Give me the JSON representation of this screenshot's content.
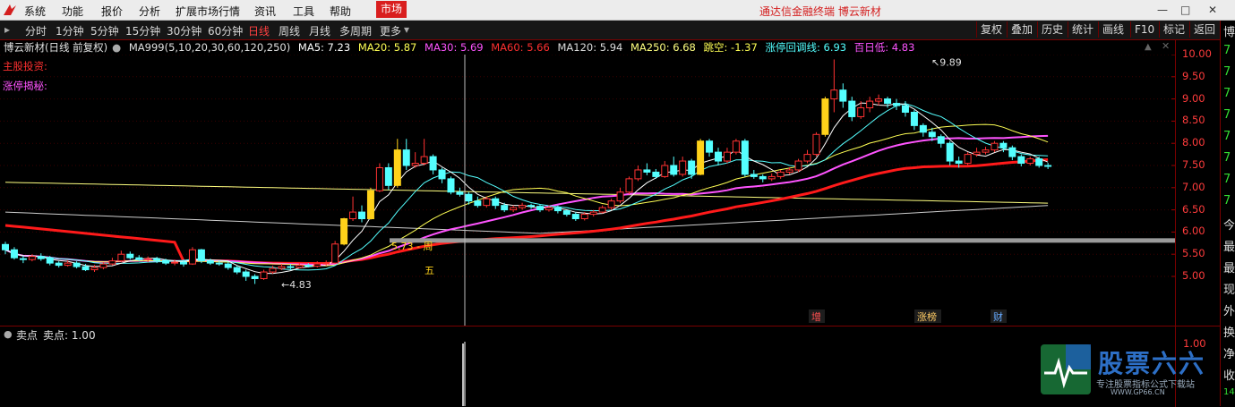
{
  "menubar": {
    "items": [
      "系统",
      "功能",
      "报价",
      "分析",
      "扩展市场行情",
      "资讯",
      "工具",
      "帮助"
    ],
    "market_label": "市场",
    "title": "通达信金融终端  博云新材"
  },
  "toolbar": {
    "periods": [
      "分时",
      "1分钟",
      "5分钟",
      "15分钟",
      "30分钟",
      "60分钟",
      "日线",
      "周线",
      "月线",
      "多周期",
      "更多"
    ],
    "active_period": "日线",
    "right_buttons": [
      "复权",
      "叠加",
      "历史",
      "统计",
      "画线",
      "F10",
      "标记",
      "返回"
    ]
  },
  "info": {
    "stock": "博云新材(日线 前复权)",
    "indicator": "MA999(5,10,20,30,60,120,250)",
    "ma5": "MA5: 7.23",
    "ma20": "MA20: 5.87",
    "ma30": "MA30: 5.69",
    "ma60": "MA60: 5.66",
    "ma120": "MA120: 5.94",
    "ma250": "MA250: 6.68",
    "jump": "跳空: -1.37",
    "limit_pullback": "涨停回调线: 6.93",
    "hundred_low": "百日低: 4.83"
  },
  "labels": {
    "main_fund": "主股投资:",
    "limit_up": "涨停揭秘:",
    "annot_left": "5.73 - 周",
    "annot_week": "五",
    "low_mark": "4.83",
    "high_mark": "9.89",
    "tag_zeng": "增",
    "tag_zhangbang": "涨榜",
    "tag_cai": "财"
  },
  "sub": {
    "title": "卖点",
    "value": "卖点: 1.00",
    "ticks": [
      "1.00"
    ]
  },
  "right_strip": [
    "博",
    "7",
    "7",
    "7",
    "7",
    "7",
    "7",
    "7",
    "7",
    "今",
    "最",
    "最",
    "现",
    "外",
    "换",
    "净",
    "收",
    "14"
  ],
  "watermark": {
    "brand": "股票六六",
    "slogan": "专注股票指标公式下载站",
    "url": "WWW.GP66.CN"
  },
  "colors": {
    "up": "#ff3232",
    "down": "#54ffff",
    "ma5": "#ffffff",
    "ma20": "#ffff54",
    "ma30": "#ff54ff",
    "ma60": "#ff1a1a",
    "ma120": "#cccccc",
    "ma250": "#ffff80"
  },
  "chart_data": {
    "type": "candlestick",
    "title": "博云新材(日线 前复权)",
    "y_ticks": [
      5.0,
      5.5,
      6.0,
      6.5,
      7.0,
      7.5,
      8.0,
      8.5,
      9.0,
      9.5,
      10.0
    ],
    "ylim": [
      4.7,
      10.1
    ],
    "candles": [
      [
        5.72,
        5.6,
        5.78,
        5.5
      ],
      [
        5.6,
        5.42,
        5.66,
        5.38
      ],
      [
        5.4,
        5.38,
        5.46,
        5.3
      ],
      [
        5.38,
        5.45,
        5.5,
        5.34
      ],
      [
        5.45,
        5.4,
        5.52,
        5.35
      ],
      [
        5.42,
        5.3,
        5.46,
        5.25
      ],
      [
        5.3,
        5.25,
        5.34,
        5.2
      ],
      [
        5.25,
        5.3,
        5.36,
        5.22
      ],
      [
        5.3,
        5.22,
        5.34,
        5.18
      ],
      [
        5.22,
        5.15,
        5.28,
        5.12
      ],
      [
        5.15,
        5.2,
        5.26,
        5.1
      ],
      [
        5.2,
        5.28,
        5.32,
        5.16
      ],
      [
        5.28,
        5.35,
        5.42,
        5.25
      ],
      [
        5.35,
        5.5,
        5.58,
        5.32
      ],
      [
        5.5,
        5.42,
        5.56,
        5.38
      ],
      [
        5.42,
        5.38,
        5.48,
        5.34
      ],
      [
        5.38,
        5.4,
        5.45,
        5.32
      ],
      [
        5.4,
        5.36,
        5.44,
        5.3
      ],
      [
        5.36,
        5.3,
        5.4,
        5.26
      ],
      [
        5.3,
        5.32,
        5.38,
        5.25
      ],
      [
        5.32,
        5.28,
        5.38,
        5.22
      ],
      [
        5.28,
        5.6,
        5.66,
        5.26
      ],
      [
        5.6,
        5.35,
        5.62,
        5.3
      ],
      [
        5.35,
        5.3,
        5.4,
        5.26
      ],
      [
        5.3,
        5.28,
        5.36,
        5.24
      ],
      [
        5.28,
        5.2,
        5.32,
        5.15
      ],
      [
        5.2,
        5.1,
        5.25,
        5.05
      ],
      [
        5.1,
        5.0,
        5.15,
        4.9
      ],
      [
        5.0,
        4.95,
        5.05,
        4.83
      ],
      [
        4.95,
        5.1,
        5.15,
        4.92
      ],
      [
        5.1,
        5.18,
        5.24,
        5.06
      ],
      [
        5.18,
        5.22,
        5.28,
        5.14
      ],
      [
        5.22,
        5.2,
        5.28,
        5.16
      ],
      [
        5.2,
        5.25,
        5.3,
        5.18
      ],
      [
        5.25,
        5.23,
        5.3,
        5.2
      ],
      [
        5.23,
        5.28,
        5.34,
        5.2
      ],
      [
        5.28,
        5.3,
        5.36,
        5.24
      ],
      [
        5.3,
        5.73,
        5.8,
        5.28
      ],
      [
        5.73,
        6.3,
        6.32,
        5.7
      ],
      [
        6.3,
        6.45,
        6.8,
        6.25
      ],
      [
        6.45,
        6.3,
        6.6,
        6.22
      ],
      [
        6.3,
        6.93,
        7.0,
        6.28
      ],
      [
        6.93,
        7.45,
        7.55,
        6.9
      ],
      [
        7.45,
        7.05,
        7.55,
        6.95
      ],
      [
        7.05,
        7.85,
        8.1,
        7.0
      ],
      [
        7.85,
        7.5,
        8.1,
        7.4
      ],
      [
        7.5,
        7.55,
        7.8,
        7.45
      ],
      [
        7.55,
        7.7,
        8.1,
        7.5
      ],
      [
        7.7,
        7.4,
        7.75,
        7.3
      ],
      [
        7.4,
        7.2,
        7.45,
        7.1
      ],
      [
        7.2,
        6.9,
        7.25,
        6.85
      ],
      [
        6.9,
        6.85,
        7.0,
        6.8
      ],
      [
        6.85,
        6.7,
        6.9,
        6.62
      ],
      [
        6.7,
        6.6,
        6.8,
        6.55
      ],
      [
        6.6,
        6.75,
        6.8,
        6.55
      ],
      [
        6.75,
        6.6,
        6.8,
        6.52
      ],
      [
        6.6,
        6.5,
        6.66,
        6.45
      ],
      [
        6.5,
        6.55,
        6.6,
        6.45
      ],
      [
        6.55,
        6.6,
        6.66,
        6.5
      ],
      [
        6.6,
        6.58,
        6.64,
        6.52
      ],
      [
        6.58,
        6.5,
        6.62,
        6.45
      ],
      [
        6.5,
        6.55,
        6.6,
        6.46
      ],
      [
        6.55,
        6.48,
        6.6,
        6.42
      ],
      [
        6.48,
        6.4,
        6.5,
        6.35
      ],
      [
        6.4,
        6.3,
        6.45,
        6.25
      ],
      [
        6.3,
        6.4,
        6.45,
        6.26
      ],
      [
        6.4,
        6.45,
        6.5,
        6.35
      ],
      [
        6.45,
        6.55,
        6.6,
        6.42
      ],
      [
        6.55,
        6.7,
        6.75,
        6.5
      ],
      [
        6.7,
        6.9,
        7.0,
        6.65
      ],
      [
        6.9,
        7.2,
        7.25,
        6.85
      ],
      [
        7.2,
        7.4,
        7.5,
        7.15
      ],
      [
        7.4,
        7.35,
        7.55,
        7.28
      ],
      [
        7.35,
        7.25,
        7.42,
        7.2
      ],
      [
        7.25,
        7.5,
        7.6,
        7.22
      ],
      [
        7.5,
        7.3,
        7.7,
        7.25
      ],
      [
        7.3,
        7.6,
        7.7,
        7.25
      ],
      [
        7.6,
        7.3,
        7.65,
        7.2
      ],
      [
        7.3,
        8.05,
        8.1,
        7.28
      ],
      [
        8.05,
        7.8,
        8.1,
        7.7
      ],
      [
        7.8,
        7.6,
        7.9,
        7.5
      ],
      [
        7.6,
        7.8,
        7.9,
        7.55
      ],
      [
        7.8,
        8.05,
        8.1,
        7.75
      ],
      [
        8.05,
        7.3,
        8.1,
        7.25
      ],
      [
        7.3,
        7.25,
        7.4,
        7.2
      ],
      [
        7.25,
        7.2,
        7.3,
        7.12
      ],
      [
        7.2,
        7.25,
        7.32,
        7.15
      ],
      [
        7.25,
        7.35,
        7.4,
        7.2
      ],
      [
        7.35,
        7.4,
        7.46,
        7.3
      ],
      [
        7.4,
        7.6,
        7.65,
        7.35
      ],
      [
        7.6,
        7.75,
        7.85,
        7.55
      ],
      [
        7.75,
        8.2,
        8.25,
        7.7
      ],
      [
        8.2,
        9.0,
        9.05,
        8.15
      ],
      [
        9.0,
        9.2,
        9.89,
        8.7
      ],
      [
        9.2,
        8.95,
        9.35,
        8.8
      ],
      [
        8.95,
        8.6,
        9.05,
        8.5
      ],
      [
        8.6,
        8.8,
        8.95,
        8.55
      ],
      [
        8.8,
        8.95,
        9.05,
        8.7
      ],
      [
        8.95,
        9.0,
        9.1,
        8.85
      ],
      [
        9.0,
        8.9,
        9.05,
        8.8
      ],
      [
        8.9,
        8.85,
        9.0,
        8.75
      ],
      [
        8.85,
        8.7,
        8.95,
        8.6
      ],
      [
        8.7,
        8.4,
        8.75,
        8.3
      ],
      [
        8.4,
        8.25,
        8.45,
        8.15
      ],
      [
        8.25,
        8.15,
        8.35,
        8.05
      ],
      [
        8.15,
        8.0,
        8.2,
        7.9
      ],
      [
        8.0,
        7.6,
        8.05,
        7.5
      ],
      [
        7.6,
        7.55,
        7.7,
        7.45
      ],
      [
        7.55,
        7.75,
        7.8,
        7.5
      ],
      [
        7.75,
        7.8,
        7.9,
        7.7
      ],
      [
        7.8,
        7.85,
        7.92,
        7.75
      ],
      [
        7.85,
        8.0,
        8.05,
        7.8
      ],
      [
        8.0,
        7.9,
        8.05,
        7.8
      ],
      [
        7.9,
        7.7,
        7.95,
        7.62
      ],
      [
        7.7,
        7.55,
        7.75,
        7.48
      ],
      [
        7.55,
        7.65,
        7.7,
        7.5
      ],
      [
        7.65,
        7.5,
        7.7,
        7.45
      ],
      [
        7.5,
        7.48,
        7.56,
        7.42
      ]
    ]
  }
}
